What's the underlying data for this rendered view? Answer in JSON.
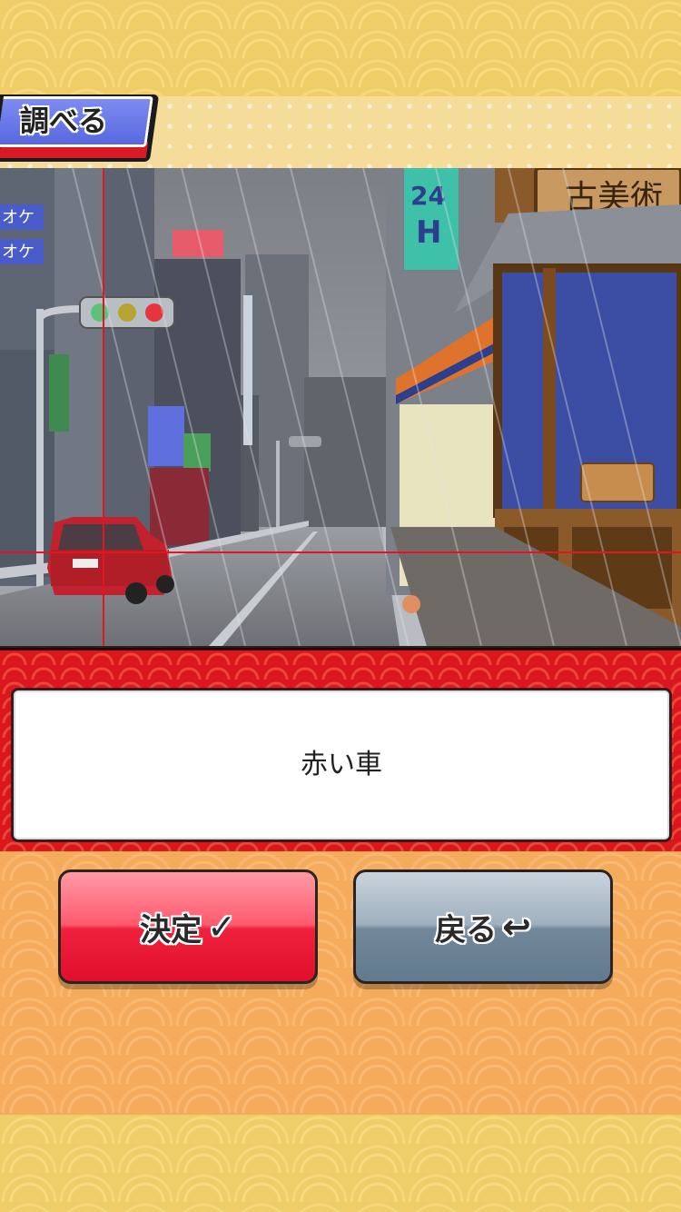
{
  "header": {
    "title": "調べる"
  },
  "scene": {
    "signs": {
      "shop_sign": "古美術",
      "h24_sign_top": "24",
      "h24_sign_bottom": "H",
      "karaoke_1": "オケ",
      "karaoke_2": "オケ"
    }
  },
  "message": {
    "text": "赤い車"
  },
  "buttons": {
    "confirm": {
      "label": "決定",
      "icon": "✓"
    },
    "back": {
      "label": "戻る",
      "icon": "↩"
    }
  },
  "colors": {
    "confirm_button": "#f0213c",
    "back_button": "#71889a",
    "crosshair": "#e8141c",
    "title_tab": "#5867de"
  },
  "icons": [
    "check-icon",
    "return-arrow-icon"
  ]
}
